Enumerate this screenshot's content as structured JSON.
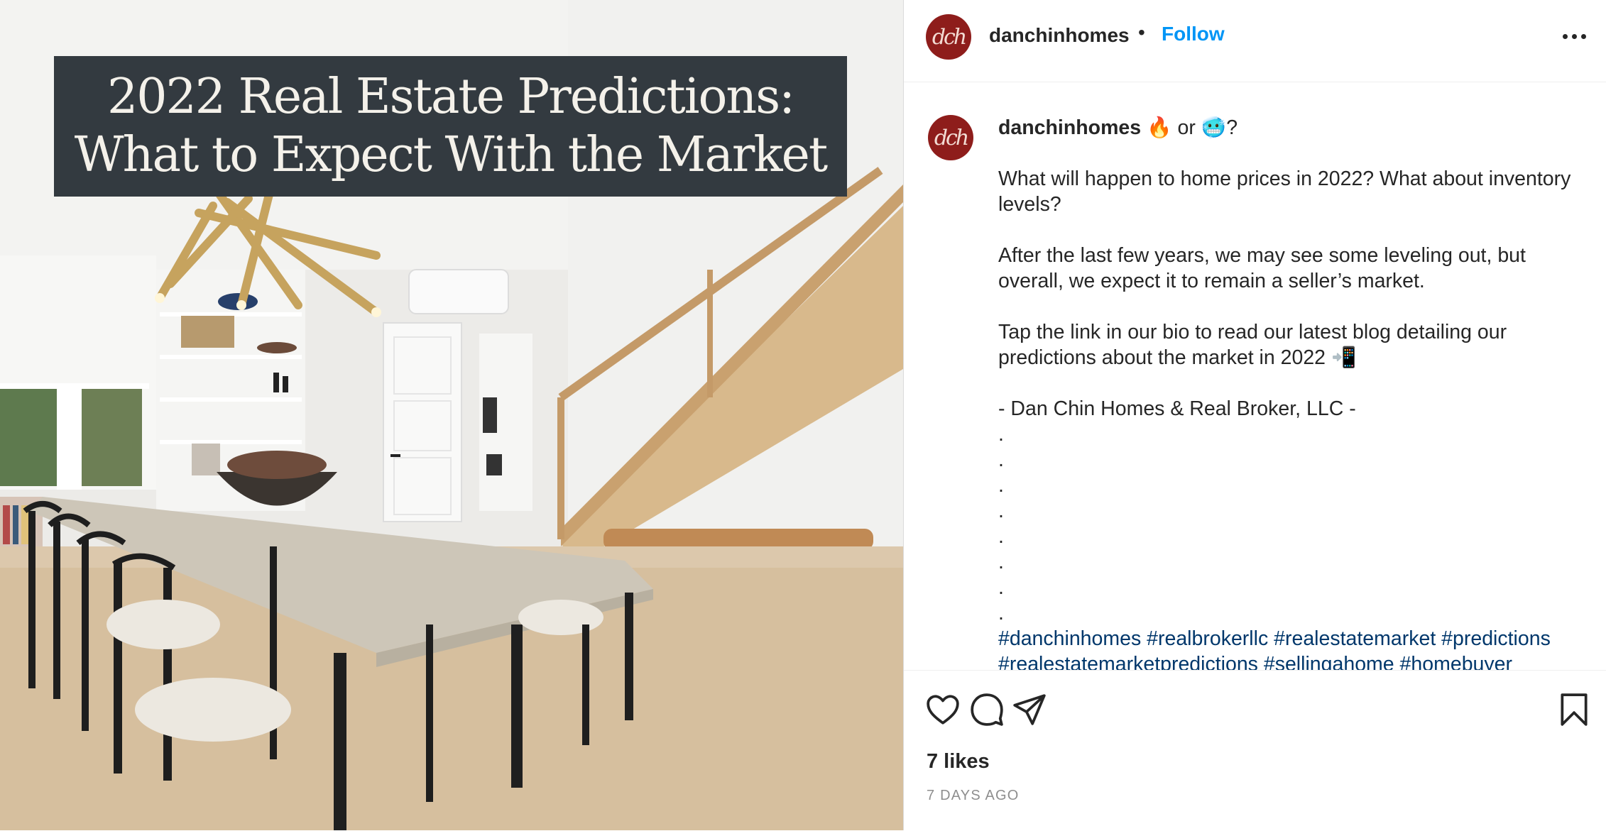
{
  "post_image": {
    "title_line1": "2022 Real Estate Predictions:",
    "title_line2": "What to Expect With the Market"
  },
  "header": {
    "avatar_text": "dch",
    "username": "danchinhomes",
    "separator": "•",
    "follow_label": "Follow"
  },
  "caption": {
    "username": "danchinhomes",
    "intro": " or ",
    "intro_end": "?",
    "emoji_fire": "🔥",
    "emoji_cold": "🥶",
    "p1": "What will happen to home prices in 2022? What about inventory levels?",
    "p2": "After the last few years, we may see some leveling out, but overall, we expect it to remain a seller’s market.",
    "p3": "Tap the link in our bio to read our latest blog detailing our predictions about the market in 2022 📲",
    "p4": "- Dan Chin Homes & Real Broker, LLC -",
    "dots": [
      ".",
      ".",
      ".",
      ".",
      ".",
      ".",
      ".",
      "."
    ],
    "hashtags_line1": "#danchinhomes #realbrokerllc #realestatemarket #predictions",
    "hashtags_line2": "#realestatemarketpredictions #sellingahome #homebuyer"
  },
  "engagement": {
    "likes": "7 likes",
    "timestamp": "7 DAYS AGO"
  },
  "icons": {
    "like": "heart-icon",
    "comment": "comment-icon",
    "share": "paper-plane-icon",
    "save": "bookmark-icon",
    "more": "more-options-icon"
  },
  "colors": {
    "follow": "#0095f6",
    "hashtag": "#00376b",
    "avatar": "#8e1d1b",
    "banner": "#333a40"
  }
}
